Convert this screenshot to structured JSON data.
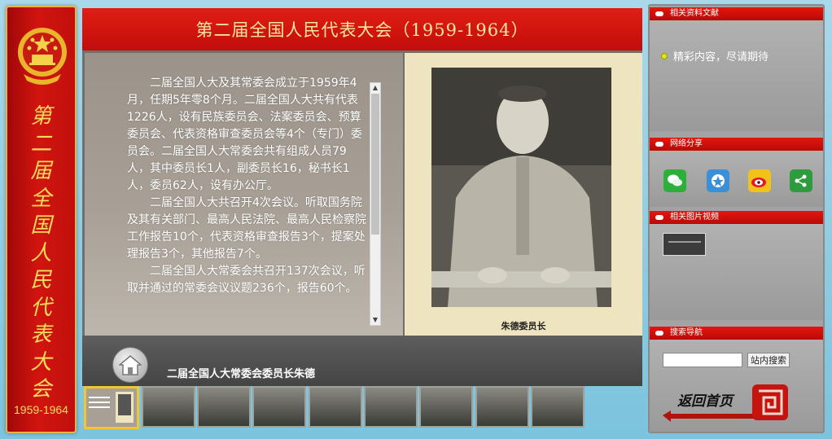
{
  "banner": {
    "title_chars": [
      "第",
      "二",
      "届",
      "全",
      "国",
      "人",
      "民",
      "代",
      "表",
      "大",
      "会"
    ],
    "years": "1959-1964"
  },
  "main": {
    "title": "第二届全国人民代表大会（1959-1964）",
    "paragraphs": [
      "二届全国人大及其常委会成立于1959年4月，任期5年零8个月。二届全国人大共有代表1226人，设有民族委员会、法案委员会、预算委员会、代表资格审查委员会等4个（专门）委员会。二届全国人大常委会共有组成人员79人，其中委员长1人，副委员长16，秘书长1人，委员62人，设有办公厅。",
      "二届全国人大共召开4次会议。听取国务院及其有关部门、最高人民法院、最高人民检察院工作报告10个，代表资格审查报告3个，提案处理报告3个，其他报告7个。",
      "二届全国人大常委会共召开137次会议，听取并通过的常委会议议题236个，报告60个。"
    ],
    "photo_caption": "朱德委员长",
    "bottom_caption": "二届全国人大常委会委员长朱德"
  },
  "thumbnails": {
    "count": 9,
    "active_index": 0
  },
  "sidebar": {
    "related_docs": {
      "header": "相关资料文献",
      "notice": "精彩内容，尽请期待"
    },
    "share": {
      "header": "网络分享",
      "icons": [
        "wechat-icon",
        "qq-zone-icon",
        "weibo-icon",
        "share-icon"
      ]
    },
    "videos": {
      "header": "相关图片视频"
    },
    "search": {
      "header": "搜索导航",
      "input_value": "",
      "button_label": "站内搜索"
    },
    "back_home_label": "返回首页"
  },
  "colors": {
    "title_red": "#d2140f",
    "gold": "#f5dd5a",
    "background_blue": "#8ccde4",
    "active_thumb_border": "#f3c530"
  }
}
